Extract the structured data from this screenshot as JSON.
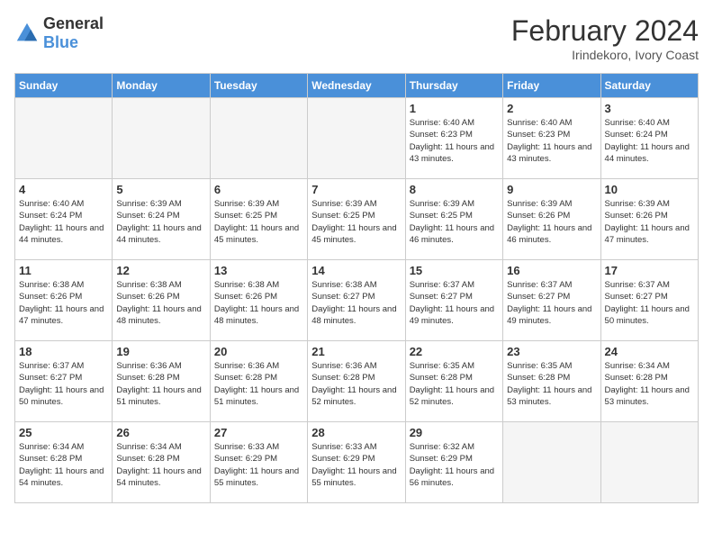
{
  "header": {
    "logo_line1": "General",
    "logo_line2": "Blue",
    "month_year": "February 2024",
    "location": "Irindekoro, Ivory Coast"
  },
  "days_of_week": [
    "Sunday",
    "Monday",
    "Tuesday",
    "Wednesday",
    "Thursday",
    "Friday",
    "Saturday"
  ],
  "weeks": [
    [
      {
        "day": "",
        "empty": true
      },
      {
        "day": "",
        "empty": true
      },
      {
        "day": "",
        "empty": true
      },
      {
        "day": "",
        "empty": true
      },
      {
        "day": "1",
        "sunrise": "6:40 AM",
        "sunset": "6:23 PM",
        "daylight": "11 hours and 43 minutes."
      },
      {
        "day": "2",
        "sunrise": "6:40 AM",
        "sunset": "6:23 PM",
        "daylight": "11 hours and 43 minutes."
      },
      {
        "day": "3",
        "sunrise": "6:40 AM",
        "sunset": "6:24 PM",
        "daylight": "11 hours and 44 minutes."
      }
    ],
    [
      {
        "day": "4",
        "sunrise": "6:40 AM",
        "sunset": "6:24 PM",
        "daylight": "11 hours and 44 minutes."
      },
      {
        "day": "5",
        "sunrise": "6:39 AM",
        "sunset": "6:24 PM",
        "daylight": "11 hours and 44 minutes."
      },
      {
        "day": "6",
        "sunrise": "6:39 AM",
        "sunset": "6:25 PM",
        "daylight": "11 hours and 45 minutes."
      },
      {
        "day": "7",
        "sunrise": "6:39 AM",
        "sunset": "6:25 PM",
        "daylight": "11 hours and 45 minutes."
      },
      {
        "day": "8",
        "sunrise": "6:39 AM",
        "sunset": "6:25 PM",
        "daylight": "11 hours and 46 minutes."
      },
      {
        "day": "9",
        "sunrise": "6:39 AM",
        "sunset": "6:26 PM",
        "daylight": "11 hours and 46 minutes."
      },
      {
        "day": "10",
        "sunrise": "6:39 AM",
        "sunset": "6:26 PM",
        "daylight": "11 hours and 47 minutes."
      }
    ],
    [
      {
        "day": "11",
        "sunrise": "6:38 AM",
        "sunset": "6:26 PM",
        "daylight": "11 hours and 47 minutes."
      },
      {
        "day": "12",
        "sunrise": "6:38 AM",
        "sunset": "6:26 PM",
        "daylight": "11 hours and 48 minutes."
      },
      {
        "day": "13",
        "sunrise": "6:38 AM",
        "sunset": "6:26 PM",
        "daylight": "11 hours and 48 minutes."
      },
      {
        "day": "14",
        "sunrise": "6:38 AM",
        "sunset": "6:27 PM",
        "daylight": "11 hours and 48 minutes."
      },
      {
        "day": "15",
        "sunrise": "6:37 AM",
        "sunset": "6:27 PM",
        "daylight": "11 hours and 49 minutes."
      },
      {
        "day": "16",
        "sunrise": "6:37 AM",
        "sunset": "6:27 PM",
        "daylight": "11 hours and 49 minutes."
      },
      {
        "day": "17",
        "sunrise": "6:37 AM",
        "sunset": "6:27 PM",
        "daylight": "11 hours and 50 minutes."
      }
    ],
    [
      {
        "day": "18",
        "sunrise": "6:37 AM",
        "sunset": "6:27 PM",
        "daylight": "11 hours and 50 minutes."
      },
      {
        "day": "19",
        "sunrise": "6:36 AM",
        "sunset": "6:28 PM",
        "daylight": "11 hours and 51 minutes."
      },
      {
        "day": "20",
        "sunrise": "6:36 AM",
        "sunset": "6:28 PM",
        "daylight": "11 hours and 51 minutes."
      },
      {
        "day": "21",
        "sunrise": "6:36 AM",
        "sunset": "6:28 PM",
        "daylight": "11 hours and 52 minutes."
      },
      {
        "day": "22",
        "sunrise": "6:35 AM",
        "sunset": "6:28 PM",
        "daylight": "11 hours and 52 minutes."
      },
      {
        "day": "23",
        "sunrise": "6:35 AM",
        "sunset": "6:28 PM",
        "daylight": "11 hours and 53 minutes."
      },
      {
        "day": "24",
        "sunrise": "6:34 AM",
        "sunset": "6:28 PM",
        "daylight": "11 hours and 53 minutes."
      }
    ],
    [
      {
        "day": "25",
        "sunrise": "6:34 AM",
        "sunset": "6:28 PM",
        "daylight": "11 hours and 54 minutes."
      },
      {
        "day": "26",
        "sunrise": "6:34 AM",
        "sunset": "6:28 PM",
        "daylight": "11 hours and 54 minutes."
      },
      {
        "day": "27",
        "sunrise": "6:33 AM",
        "sunset": "6:29 PM",
        "daylight": "11 hours and 55 minutes."
      },
      {
        "day": "28",
        "sunrise": "6:33 AM",
        "sunset": "6:29 PM",
        "daylight": "11 hours and 55 minutes."
      },
      {
        "day": "29",
        "sunrise": "6:32 AM",
        "sunset": "6:29 PM",
        "daylight": "11 hours and 56 minutes."
      },
      {
        "day": "",
        "empty": true
      },
      {
        "day": "",
        "empty": true
      }
    ]
  ]
}
